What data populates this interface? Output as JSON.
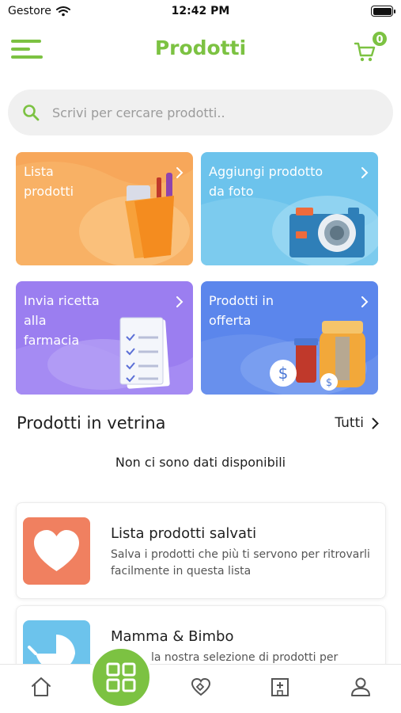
{
  "status_bar": {
    "carrier": "Gestore",
    "time": "12:42 PM"
  },
  "header": {
    "title": "Prodotti",
    "cart_count": "0"
  },
  "search": {
    "placeholder": "Scrivi per cercare prodotti.."
  },
  "tiles": [
    {
      "label": "Lista\nprodotti",
      "color": "#f7a75a"
    },
    {
      "label": "Aggiungi prodotto\nda foto",
      "color": "#6cc3ec"
    },
    {
      "label": "Invia ricetta\nalla\nfarmacia",
      "color": "#9b7ef0"
    },
    {
      "label": "Prodotti in\nofferta",
      "color": "#5b86ec"
    }
  ],
  "showcase": {
    "title": "Prodotti in vetrina",
    "see_all": "Tutti",
    "empty": "Non ci sono dati disponibili"
  },
  "cards": [
    {
      "title": "Lista prodotti salvati",
      "description": "Salva i prodotti che più ti servono per ritrovarli facilmente in questa lista",
      "icon": "heart-icon",
      "color": "#f08060"
    },
    {
      "title": "Mamma & Bimbo",
      "description": "la nostra selezione di prodotti per",
      "icon": "stroller-icon",
      "color": "#6cc3ec"
    }
  ],
  "bottom_nav": {
    "items": [
      "home-icon",
      "grid-icon",
      "heart-hand-icon",
      "pharmacy-icon",
      "user-icon"
    ],
    "active": "grid-icon"
  },
  "colors": {
    "accent": "#7cc242",
    "text": "#1f1f1f"
  }
}
